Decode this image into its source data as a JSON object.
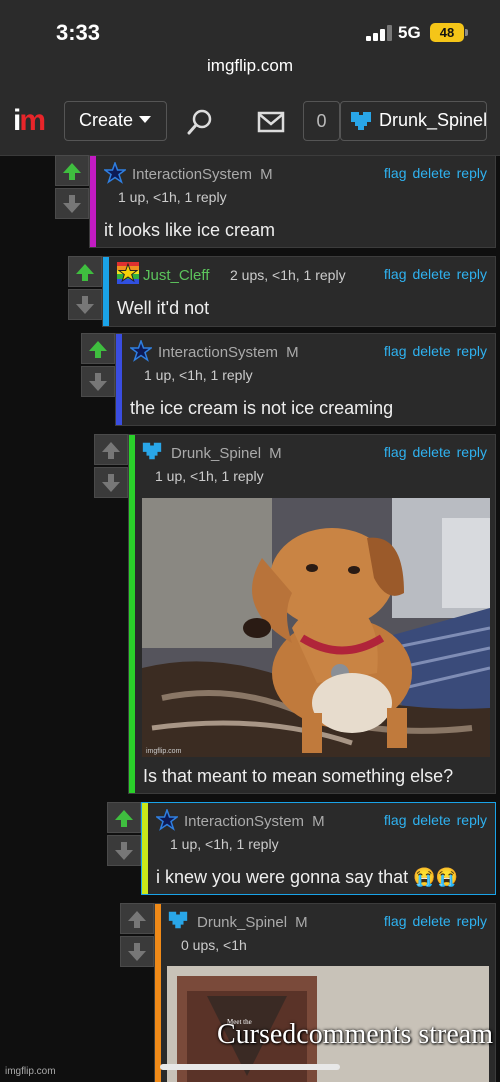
{
  "status": {
    "time": "3:33",
    "network": "5G",
    "battery": "48"
  },
  "browser": {
    "url": "imgflip.com"
  },
  "header": {
    "logo_i": "i",
    "logo_m": "m",
    "create_label": "Create",
    "points": "0",
    "username": "Drunk_Spinel"
  },
  "colors": {
    "link": "#2fb2f0",
    "upvote": "#3fbe3f",
    "logo_red": "#e8252a"
  },
  "actions": {
    "flag": "flag",
    "delete": "delete",
    "reply": "reply"
  },
  "comments": [
    {
      "author": "InteractionSystem",
      "badge": "M",
      "meta": "1 up, <1h, 1 reply",
      "text": "it looks like ice cream",
      "bar_color": "#c21bc2",
      "voted": "up"
    },
    {
      "author": "Just_Cleff",
      "badge": "",
      "meta": "2 ups, <1h, 1 reply",
      "text": "Well it'd not",
      "bar_color": "#1aa3e8",
      "voted": "up"
    },
    {
      "author": "InteractionSystem",
      "badge": "M",
      "meta": "1 up, <1h, 1 reply",
      "text": "the ice cream is not ice creaming",
      "bar_color": "#3a4de0",
      "voted": "up"
    },
    {
      "author": "Drunk_Spinel",
      "badge": "M",
      "meta": "1 up, <1h, 1 reply",
      "text": "Is that meant to mean something else?",
      "bar_color": "#2ad12a",
      "voted": "none"
    },
    {
      "author": "InteractionSystem",
      "badge": "M",
      "meta": "1 up, <1h, 1 reply",
      "text": "i knew you were gonna say that 😭😭",
      "bar_color": "#c9e81a",
      "voted": "up"
    },
    {
      "author": "Drunk_Spinel",
      "badge": "M",
      "meta": "0 ups, <1h",
      "text": "",
      "bar_color": "#f08a18",
      "voted": "none"
    }
  ],
  "images": {
    "dog_watermark": "imgflip.com",
    "meme_small_text": "Meet the"
  },
  "footer": {
    "watermark": "imgflip.com",
    "stream_label": "Cursedcomments stream"
  }
}
